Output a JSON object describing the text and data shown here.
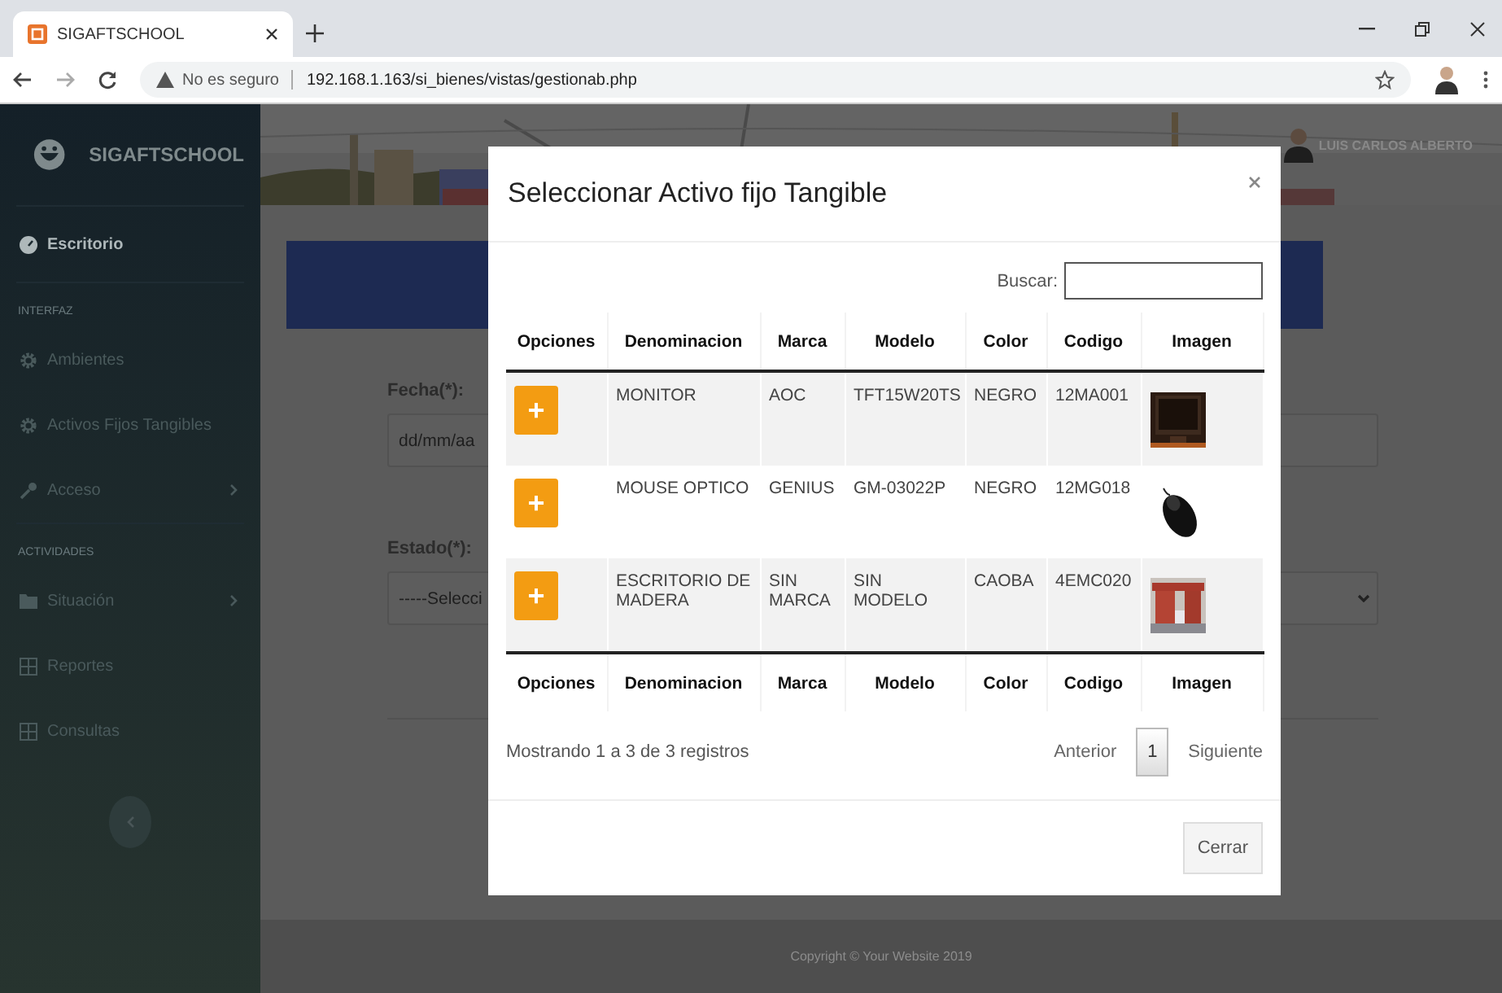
{
  "browser": {
    "tab_title": "SIGAFTSCHOOL",
    "warning": "No es seguro",
    "url": "192.168.1.163/si_bienes/vistas/gestionab.php"
  },
  "sidebar": {
    "brand": "SIGAFTSCHOOL",
    "items": [
      {
        "kind": "item",
        "label": "Escritorio",
        "active": true,
        "submenu": false
      },
      {
        "kind": "heading",
        "label": "INTERFAZ"
      },
      {
        "kind": "item",
        "label": "Ambientes",
        "active": false,
        "submenu": false
      },
      {
        "kind": "item",
        "label": "Activos Fijos Tangibles",
        "active": false,
        "submenu": false
      },
      {
        "kind": "item",
        "label": "Acceso",
        "active": false,
        "submenu": true
      },
      {
        "kind": "heading",
        "label": "ACTIVIDADES"
      },
      {
        "kind": "item",
        "label": "Situación",
        "active": false,
        "submenu": true
      },
      {
        "kind": "item",
        "label": "Reportes",
        "active": false,
        "submenu": false
      },
      {
        "kind": "item",
        "label": "Consultas",
        "active": false,
        "submenu": false
      }
    ]
  },
  "header": {
    "user_name": "LUIS CARLOS ALBERTO"
  },
  "form": {
    "fields": [
      {
        "label": "Fecha(*):",
        "kind": "date",
        "value": "dd/mm/aa"
      },
      {
        "label": "Estado(*):",
        "kind": "select",
        "value": "-----Selecci"
      }
    ]
  },
  "modal": {
    "title": "Seleccionar Activo fijo Tangible",
    "search_label": "Buscar:",
    "columns": [
      "Opciones",
      "Denominacion",
      "Marca",
      "Modelo",
      "Color",
      "Codigo",
      "Imagen"
    ],
    "rows": [
      {
        "add": "+",
        "denominacion": "MONITOR",
        "marca": "AOC",
        "modelo": "TFT15W20TS",
        "color_name": "NEGRO",
        "codigo": "12MA001"
      },
      {
        "add": "+",
        "denominacion": "MOUSE OPTICO",
        "marca": "GENIUS",
        "modelo": "GM-03022P",
        "color_name": "NEGRO",
        "codigo": "12MG018"
      },
      {
        "add": "+",
        "denominacion": "ESCRITORIO DE MADERA",
        "marca": "SIN MARCA",
        "modelo": "SIN MODELO",
        "color_name": "CAOBA",
        "codigo": "4EMC020"
      }
    ],
    "footer_columns": [
      "Opciones",
      "Denominacion",
      "Marca",
      "Modelo",
      "Color",
      "Codigo",
      "Imagen"
    ],
    "info": "Mostrando 1 a 3 de 3 registros",
    "pagination": {
      "previous": "Anterior",
      "pages": [
        {
          "label": "1",
          "selected": true
        }
      ],
      "next": "Siguiente"
    },
    "close_button": "Cerrar"
  },
  "footer": {
    "copyright": "Copyright © Your Website 2019"
  }
}
